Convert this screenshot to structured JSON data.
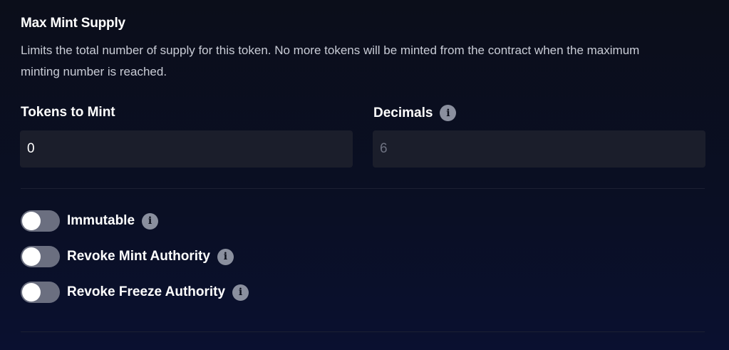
{
  "max_mint_supply": {
    "title": "Max Mint Supply",
    "description": "Limits the total number of supply for this token. No more tokens will be minted from the contract when the maximum minting number is reached."
  },
  "fields": {
    "tokens_to_mint": {
      "label": "Tokens to Mint",
      "value": "0"
    },
    "decimals": {
      "label": "Decimals",
      "placeholder": "6",
      "icon": "info-icon"
    }
  },
  "toggles": [
    {
      "label": "Immutable",
      "on": false,
      "icon": "info-icon"
    },
    {
      "label": "Revoke Mint Authority",
      "on": false,
      "icon": "info-icon"
    },
    {
      "label": "Revoke Freeze Authority",
      "on": false,
      "icon": "info-icon"
    }
  ],
  "colors": {
    "background": "#0b0e1a",
    "input_bg": "#1b1e2b",
    "toggle_off": "#6b6f80",
    "text": "#ffffff",
    "muted_text": "#c9ccd6"
  }
}
